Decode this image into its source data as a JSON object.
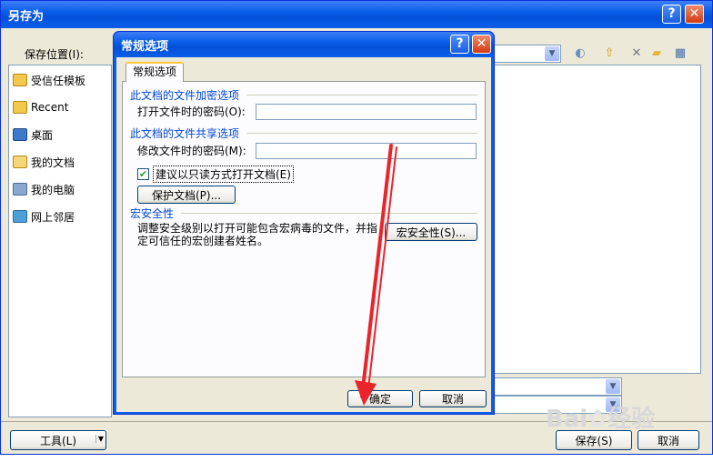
{
  "outer_window": {
    "title": "另存为",
    "help_button": "?",
    "close_button": "✕",
    "save_in_label": "保存位置(I):",
    "places": [
      {
        "label": "受信任模板",
        "icon": "folder-icon"
      },
      {
        "label": "Recent",
        "icon": "folder-icon"
      },
      {
        "label": "桌面",
        "icon": "desktop-icon"
      },
      {
        "label": "我的文档",
        "icon": "documents-icon"
      },
      {
        "label": "我的电脑",
        "icon": "computer-icon"
      },
      {
        "label": "网上邻居",
        "icon": "network-icon"
      }
    ],
    "tools_button": "工具(L)",
    "save_button": "保存(S)",
    "cancel_button": "取消"
  },
  "dialog": {
    "title": "常规选项",
    "help_button": "?",
    "close_button": "✕",
    "tab_label": "常规选项",
    "encrypt_section": "此文档的文件加密选项",
    "open_password_label": "打开文件时的密码(O):",
    "open_password_value": "",
    "share_section": "此文档的文件共享选项",
    "modify_password_label": "修改文件时的密码(M):",
    "modify_password_value": "",
    "readonly_checked": true,
    "readonly_label": "建议以只读方式打开文档(E)",
    "protect_button": "保护文档(P)...",
    "macro_section": "宏安全性",
    "macro_description": "调整安全级别以打开可能包含宏病毒的文件，并指定可信任的宏创建者姓名。",
    "macro_button": "宏安全性(S)...",
    "ok_button": "确定",
    "cancel_button": "取消"
  },
  "watermark": "Bai 经验",
  "annotation_color": "#e8252b"
}
